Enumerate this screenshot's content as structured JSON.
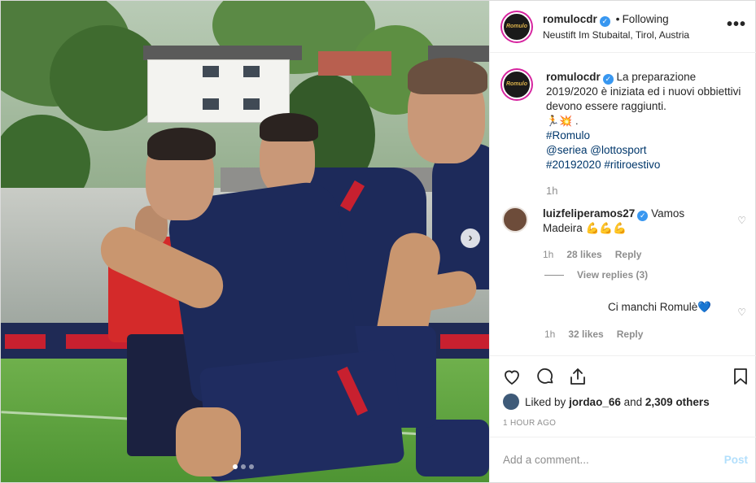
{
  "post": {
    "author": "romulocdr",
    "author_avatar_text": "Romulo",
    "follow_separator": "•",
    "follow_status": "Following",
    "location": "Neustift Im Stubaital, Tirol, Austria",
    "more_icon": "more-horizontal-icon"
  },
  "photo": {
    "next_icon": "chevron-right-icon",
    "carousel": {
      "total": 3,
      "active": 1
    }
  },
  "caption": {
    "username": "romulocdr",
    "text": "La preparazione 2019/2020 è iniziata ed i nuovi obbiettivi devono essere raggiunti.",
    "emojis": "🏃💥 .",
    "hashtag_1": "#Romulo",
    "mention_1": "@seriea",
    "mention_2": "@lottosport",
    "hashtag_2": "#20192020",
    "hashtag_3": "#ritiroestivo",
    "time": "1h"
  },
  "comments": [
    {
      "username": "luizfeliperamos27",
      "text": "Vamos Madeira 💪💪💪",
      "time": "1h",
      "likes": "28 likes",
      "reply_label": "Reply",
      "view_replies": "View replies (3)"
    },
    {
      "text": "Ci manchi Romulè💙",
      "time": "1h",
      "likes": "32 likes",
      "reply_label": "Reply"
    }
  ],
  "actions": {
    "like_icon": "heart-icon",
    "comment_icon": "comment-icon",
    "share_icon": "share-icon",
    "save_icon": "bookmark-icon",
    "liked_by_prefix": "Liked by",
    "liked_by_user": "jordao_66",
    "liked_by_and": "and",
    "liked_by_others": "2,309 others",
    "posted_ago": "1 HOUR AGO"
  },
  "composer": {
    "placeholder": "Add a comment...",
    "post_label": "Post"
  },
  "colors": {
    "verified": "#3897f0",
    "link": "#00376b",
    "post_button_disabled": "#b2dffc",
    "kit_navy": "#1d2a5a",
    "kit_red": "#c8202f"
  }
}
